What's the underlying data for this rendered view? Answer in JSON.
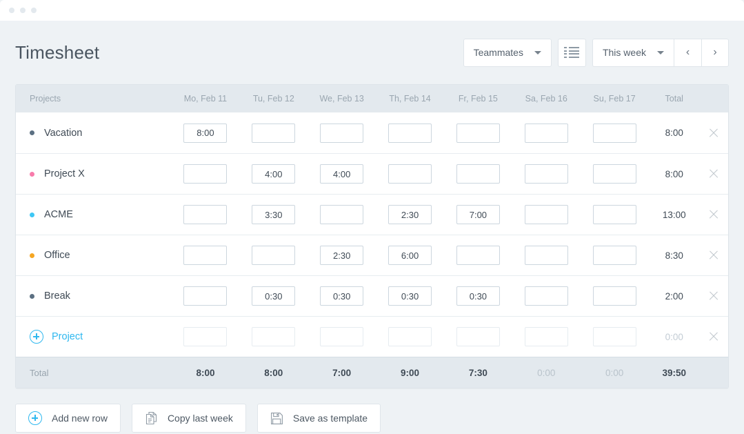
{
  "titlebar": {
    "dots": 3
  },
  "header": {
    "title": "Timesheet",
    "teammates_label": "Teammates",
    "list_view_icon": "list-icon",
    "week_label": "This week",
    "prev_label": "‹",
    "next_label": "›"
  },
  "table": {
    "columns": [
      "Projects",
      "Mo, Feb 11",
      "Tu, Feb 12",
      "We, Feb 13",
      "Th, Feb 14",
      "Fr, Feb 15",
      "Sa, Feb 16",
      "Su, Feb 17",
      "Total"
    ],
    "rows": [
      {
        "name": "Vacation",
        "color": "#5c7082",
        "days": [
          "8:00",
          "",
          "",
          "",
          "",
          "",
          ""
        ],
        "total": "8:00"
      },
      {
        "name": "Project X",
        "color": "#f87bab",
        "days": [
          "",
          "4:00",
          "4:00",
          "",
          "",
          "",
          ""
        ],
        "total": "8:00"
      },
      {
        "name": "ACME",
        "color": "#3ec7f5",
        "days": [
          "",
          "3:30",
          "",
          "2:30",
          "7:00",
          "",
          ""
        ],
        "total": "13:00"
      },
      {
        "name": "Office",
        "color": "#f5a623",
        "days": [
          "",
          "",
          "2:30",
          "6:00",
          "",
          "",
          ""
        ],
        "total": "8:30"
      },
      {
        "name": "Break",
        "color": "#5c7082",
        "days": [
          "",
          "0:30",
          "0:30",
          "0:30",
          "0:30",
          "",
          ""
        ],
        "total": "2:00"
      }
    ],
    "add_row": {
      "label": "Project",
      "icon": "plus-circle-icon",
      "days": [
        "",
        "",
        "",
        "",
        "",
        "",
        ""
      ],
      "total": "0:00"
    },
    "totals": {
      "label": "Total",
      "days": [
        "8:00",
        "8:00",
        "7:00",
        "9:00",
        "7:30",
        "0:00",
        "0:00"
      ],
      "zero_flags": [
        false,
        false,
        false,
        false,
        false,
        true,
        true
      ],
      "grand_total": "39:50"
    },
    "delete_icon": "close-icon"
  },
  "footer": {
    "buttons": [
      {
        "label": "Add new row",
        "icon": "plus-circle-icon"
      },
      {
        "label": "Copy last week",
        "icon": "copy-icon"
      },
      {
        "label": "Save as template",
        "icon": "floppy-disk-icon"
      }
    ]
  },
  "colors": {
    "accent": "#2fb8ef",
    "page_bg": "#eef2f5",
    "header_bg": "#e3e9ee"
  }
}
